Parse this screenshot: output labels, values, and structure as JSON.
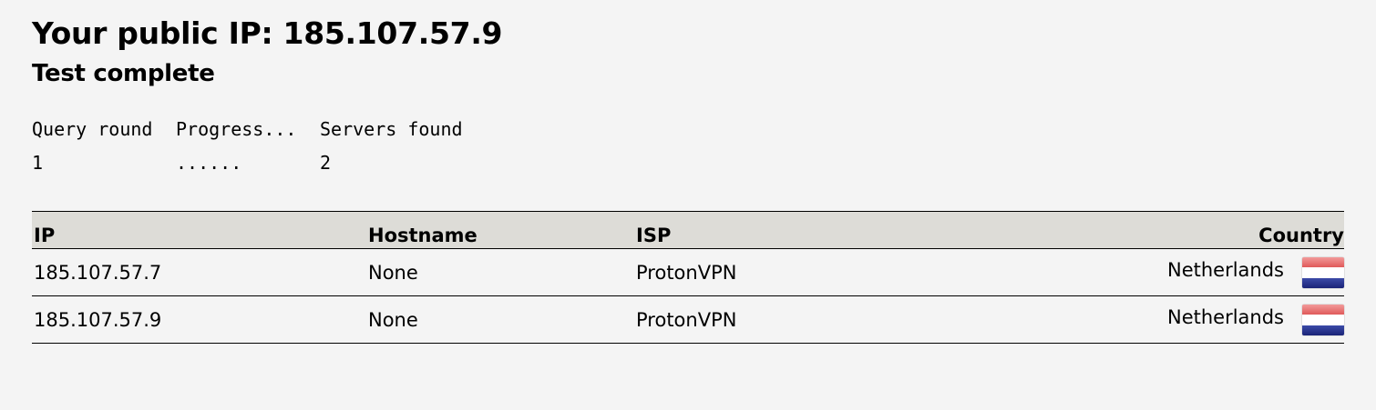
{
  "header": {
    "title": "Your public IP: 185.107.57.9",
    "subtitle": "Test complete"
  },
  "progress": {
    "headers": [
      "Query round",
      "Progress...",
      "Servers found"
    ],
    "rows": [
      [
        "1",
        "......",
        "2"
      ]
    ]
  },
  "results": {
    "columns": {
      "ip": "IP",
      "hostname": "Hostname",
      "isp": "ISP",
      "country": "Country"
    },
    "rows": [
      {
        "ip": "185.107.57.7",
        "hostname": "None",
        "isp": "ProtonVPN",
        "country": "Netherlands",
        "flag_icon": "netherlands-flag-icon"
      },
      {
        "ip": "185.107.57.9",
        "hostname": "None",
        "isp": "ProtonVPN",
        "country": "Netherlands",
        "flag_icon": "netherlands-flag-icon"
      }
    ]
  },
  "colors": {
    "background": "#f4f4f4",
    "table_header": "#dddcd7",
    "flag_red": "#e05a5a",
    "flag_blue": "#1a2478"
  }
}
